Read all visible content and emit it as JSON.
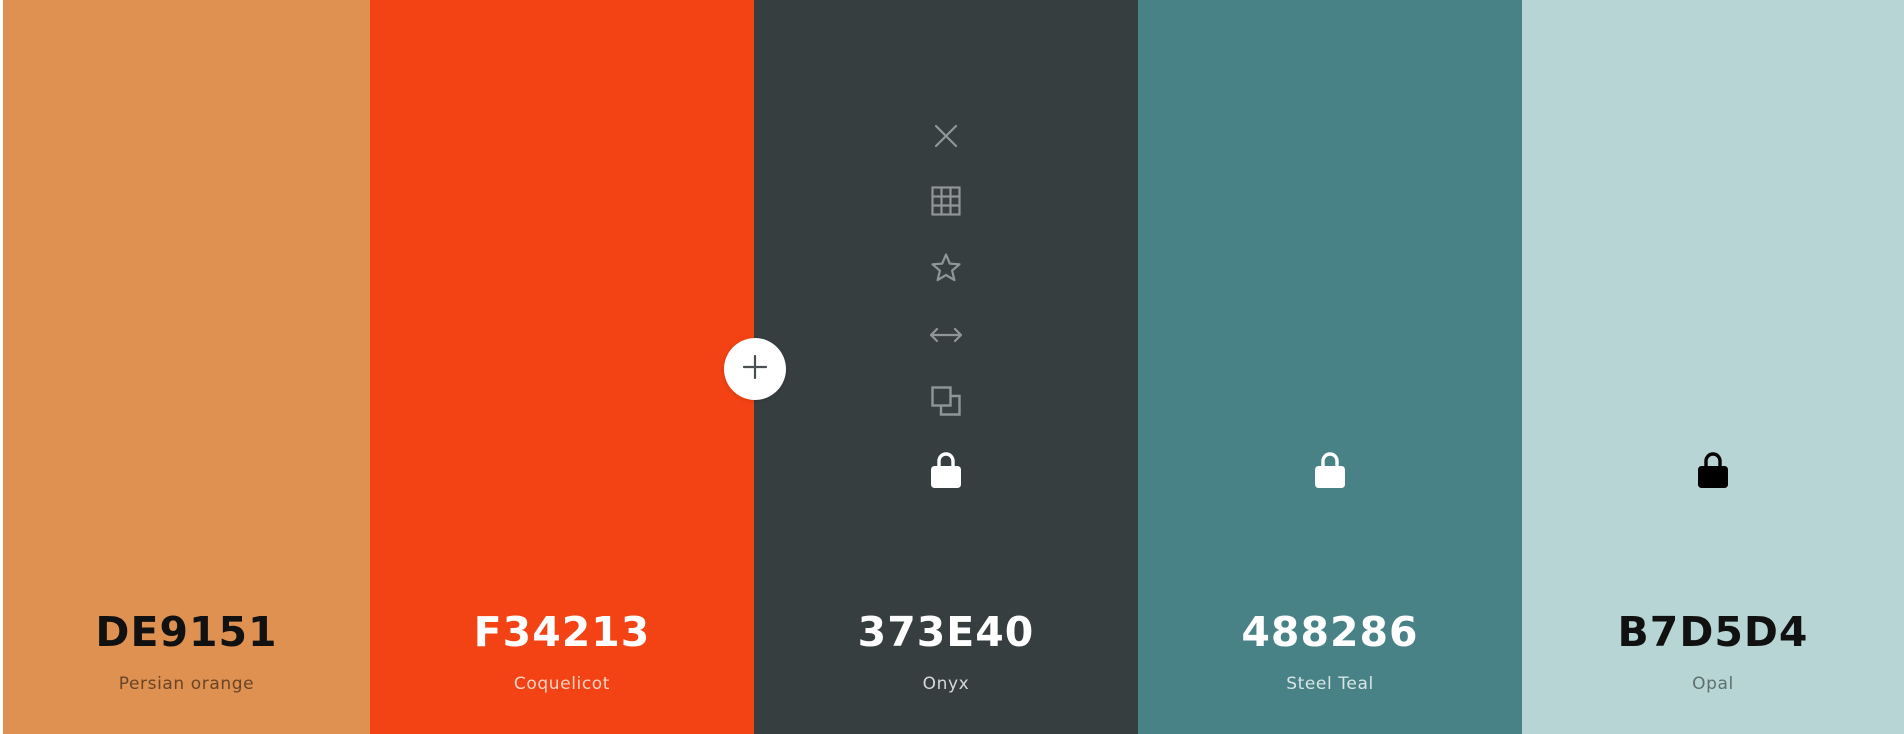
{
  "swatches": [
    {
      "hex": "DE9151",
      "name": "Persian orange",
      "bg": "#DE9151",
      "hex_color": "#111111",
      "name_color": "#6a4426"
    },
    {
      "hex": "F34213",
      "name": "Coquelicot",
      "bg": "#F34213",
      "hex_color": "#ffffff",
      "name_color": "#fbd3c6"
    },
    {
      "hex": "373E40",
      "name": "Onyx",
      "bg": "#373E40",
      "hex_color": "#ffffff",
      "name_color": "#d6d9da"
    },
    {
      "hex": "488286",
      "name": "Steel Teal",
      "bg": "#488286",
      "hex_color": "#ffffff",
      "name_color": "#d8e6e7"
    },
    {
      "hex": "B7D5D4",
      "name": "Opal",
      "bg": "#B7D5D4",
      "hex_color": "#111111",
      "name_color": "#5d6f6e"
    }
  ],
  "toolbar_icons": [
    "close-icon",
    "grid-icon",
    "star-icon",
    "drag-icon",
    "copy-icon",
    "lock-icon"
  ],
  "lock_icons": {
    "steel_teal": "lock-icon",
    "opal": "lock-icon"
  },
  "add_button_icon": "plus-icon",
  "colors": {
    "icon_gray": "#8f9698",
    "icon_white": "#ffffff",
    "icon_black": "#000000"
  }
}
